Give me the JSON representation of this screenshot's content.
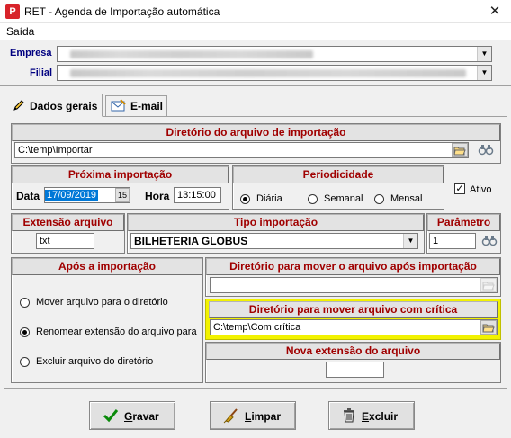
{
  "window": {
    "icon_glyph": "P",
    "title": "RET - Agenda de Importação automática",
    "close_glyph": "✕"
  },
  "menu": {
    "items": [
      "Saída"
    ]
  },
  "empresa": {
    "label": "Empresa",
    "value": ""
  },
  "filial": {
    "label": "Filial",
    "value": ""
  },
  "tabs": [
    {
      "label": "Dados gerais",
      "icon": "pencil-icon",
      "active": true
    },
    {
      "label": "E-mail",
      "icon": "envelope-icon",
      "active": false
    }
  ],
  "diretorio_importacao": {
    "header": "Diretório do arquivo de importação",
    "value": "C:\\temp\\Importar"
  },
  "proxima": {
    "header": "Próxima importação",
    "data_label": "Data",
    "data_value": "17/09/2019",
    "hora_label": "Hora",
    "hora_value": "13:15:00"
  },
  "periodicidade": {
    "header": "Periodicidade",
    "options": [
      "Diária",
      "Semanal",
      "Mensal"
    ],
    "selected": "Diária"
  },
  "ativo": {
    "label": "Ativo",
    "checked": true
  },
  "extensao": {
    "header": "Extensão arquivo",
    "value": "txt"
  },
  "tipo": {
    "header": "Tipo importação",
    "value": "BILHETERIA GLOBUS"
  },
  "parametro": {
    "header": "Parâmetro",
    "value": "1"
  },
  "apos": {
    "header": "Após a importação",
    "options": [
      "Mover arquivo para o diretório",
      "Renomear extensão do arquivo para",
      "Excluir arquivo do diretório"
    ],
    "selected": "Renomear extensão do arquivo para"
  },
  "mover": {
    "header": "Diretório para mover o arquivo após importação",
    "value": ""
  },
  "critica": {
    "header": "Diretório para mover arquivo com crítica",
    "value": "C:\\temp\\Com crítica",
    "highlight": "#f2f200"
  },
  "nova_ext": {
    "header": "Nova extensão do arquivo",
    "value": ""
  },
  "buttons": {
    "gravar": {
      "pre": "",
      "accel": "G",
      "post": "ravar",
      "icon": "check-icon"
    },
    "limpar": {
      "pre": "",
      "accel": "L",
      "post": "impar",
      "icon": "broom-icon"
    },
    "excluir": {
      "pre": "",
      "accel": "E",
      "post": "xcluir",
      "icon": "trash-icon"
    }
  },
  "colors": {
    "header_text": "#a00000",
    "label_navy": "#000080",
    "check_green": "#0a8a0a",
    "selection": "#0078d7"
  }
}
